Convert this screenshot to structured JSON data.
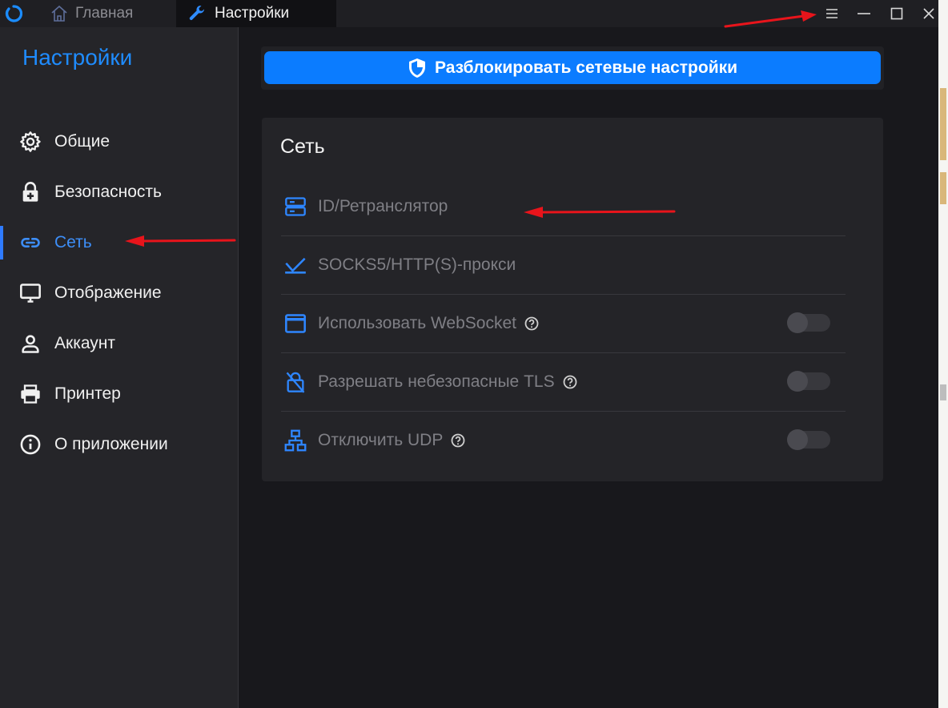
{
  "titlebar": {
    "tabs": [
      {
        "label": "Главная",
        "icon": "home-icon"
      },
      {
        "label": "Настройки",
        "icon": "wrench-icon"
      }
    ],
    "buttons": [
      "menu-icon",
      "minimize-icon",
      "maximize-icon",
      "close-icon"
    ]
  },
  "sidebar": {
    "title": "Настройки",
    "items": [
      {
        "label": "Общие",
        "icon": "gear-icon"
      },
      {
        "label": "Безопасность",
        "icon": "lock-plus-icon"
      },
      {
        "label": "Сеть",
        "icon": "link-icon",
        "active": true
      },
      {
        "label": "Отображение",
        "icon": "monitor-icon"
      },
      {
        "label": "Аккаунт",
        "icon": "user-icon"
      },
      {
        "label": "Принтер",
        "icon": "printer-icon"
      },
      {
        "label": "О приложении",
        "icon": "info-icon"
      }
    ]
  },
  "main": {
    "unlock_button": {
      "label": "Разблокировать сетевые настройки",
      "icon": "shield-icon"
    },
    "card": {
      "title": "Сеть",
      "rows": [
        {
          "label": "ID/Ретранслятор",
          "icon": "server-icon"
        },
        {
          "label": "SOCKS5/HTTP(S)-прокси",
          "icon": "proxy-icon"
        },
        {
          "label": "Использовать WebSocket",
          "icon": "window-icon",
          "help": true,
          "toggle": false
        },
        {
          "label": "Разрешать небезопасные TLS",
          "icon": "lock-off-icon",
          "help": true,
          "toggle": false
        },
        {
          "label": "Отключить UDP",
          "icon": "network-icon",
          "help": true,
          "toggle": false
        }
      ]
    }
  },
  "colors": {
    "accent": "#0b7cff",
    "sidebar_title": "#1f8cff",
    "annotation_arrow": "#e8141b"
  }
}
